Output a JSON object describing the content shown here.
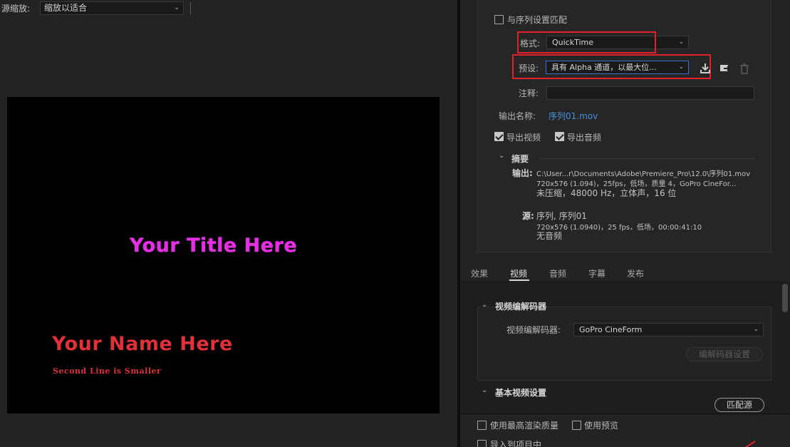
{
  "left": {
    "source_scale_label": "源缩放:",
    "source_scale_value": "缩放以适合",
    "preview": {
      "title": "Your Title Here",
      "name": "Your Name Here",
      "second_line": "Second Line is Smaller"
    }
  },
  "export": {
    "match_sequence_label": "与序列设置匹配",
    "format_label": "格式:",
    "format_value": "QuickTime",
    "preset_label": "预设:",
    "preset_value": "具有 Alpha 通道，以最大位...",
    "comment_label": "注释:",
    "comment_value": "",
    "output_name_label": "输出名称:",
    "output_name_value": "序列01.mov",
    "export_video_label": "导出视频",
    "export_audio_label": "导出音频",
    "summary_label": "摘要",
    "output_label": "输出:",
    "output_line1": "C:\\User...r\\Documents\\Adobe\\Premiere_Pro\\12.0\\序列01.mov",
    "output_line2": "720x576 (1.094)，25fps，低场，质量 4，GoPro CineFor...",
    "output_line3": "未压缩，48000 Hz，立体声，16 位",
    "source_label": "源:",
    "source_line1": "序列, 序列01",
    "source_line2": "720x576 (1.0940)，25 fps，低场，00:00:41:10",
    "source_line3": "无音频"
  },
  "tabs": [
    {
      "label": "效果"
    },
    {
      "label": "视频"
    },
    {
      "label": "音频"
    },
    {
      "label": "字幕"
    },
    {
      "label": "发布"
    }
  ],
  "video": {
    "codec_section_title": "视频编解码器",
    "codec_label": "视频编解码器:",
    "codec_value": "GoPro CineForm",
    "codec_settings_button": "编解码器设置",
    "basic_section_title": "基本视频设置",
    "match_source_button": "匹配源"
  },
  "bottom": {
    "max_render_label": "使用最高渲染质量",
    "use_preview_label": "使用预览",
    "import_label": "导入到项目中"
  },
  "colors": {
    "highlight_box": "#e0202a",
    "link": "#4a8fe0",
    "title_magenta": "#e62ee6",
    "name_red": "#e0303a"
  }
}
